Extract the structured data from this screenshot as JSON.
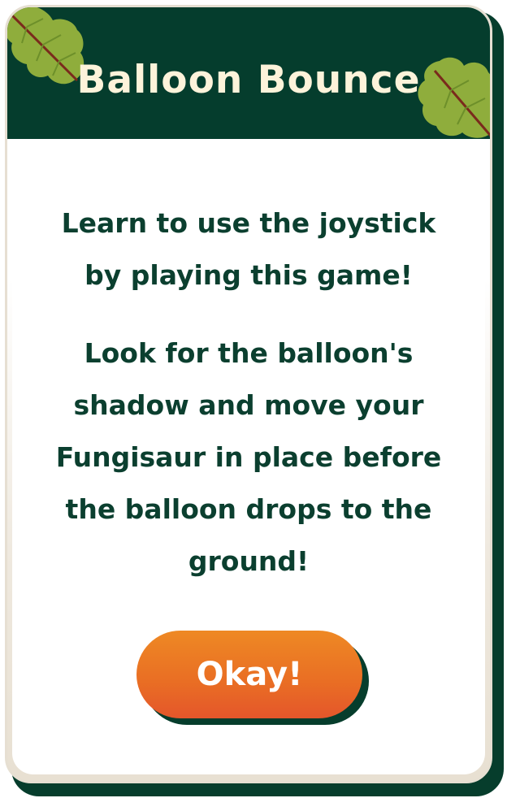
{
  "dialog": {
    "title": "Balloon Bounce",
    "message_paragraphs": [
      "Learn to use the joystick by playing this game!",
      "Look for the balloon's shadow and move your Fungisaur in place before the balloon drops to the ground!"
    ],
    "confirm_label": "Okay!"
  },
  "colors": {
    "header_bg": "#053d2d",
    "title_text": "#fdf3da",
    "body_text": "#0b3f2f",
    "button_orange": "#e96d24",
    "leaf_green": "#8fad3c"
  },
  "icons": {
    "header_decoration_left": "leaf-icon",
    "header_decoration_right": "leaf-icon"
  }
}
